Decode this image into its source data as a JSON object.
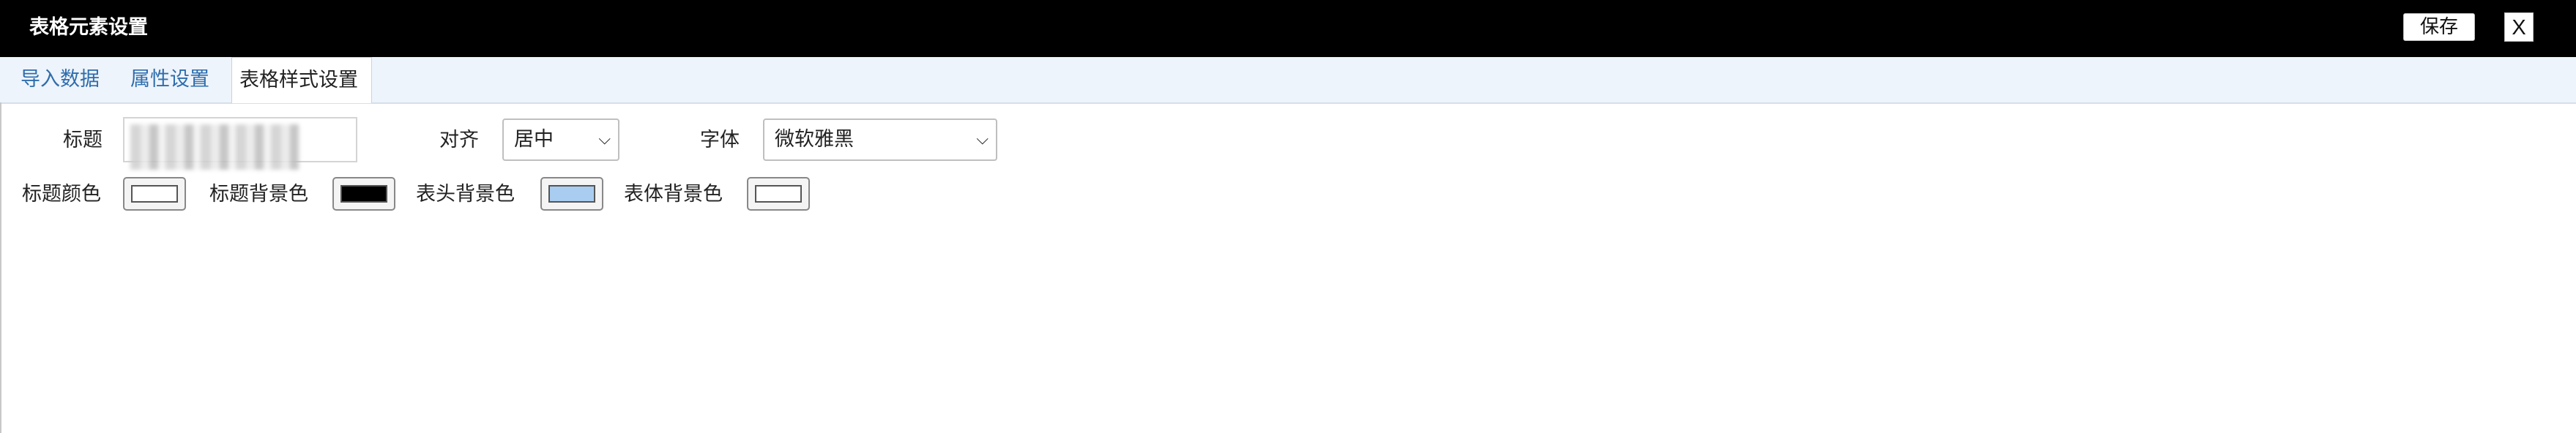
{
  "window": {
    "title": "表格元素设置",
    "save_label": "保存",
    "close_label": "X"
  },
  "tabs": [
    {
      "label": "导入数据",
      "active": false
    },
    {
      "label": "属性设置",
      "active": false
    },
    {
      "label": "表格样式设置",
      "active": true
    }
  ],
  "form": {
    "title_label": "标题",
    "title_value": "",
    "align_label": "对齐",
    "align_value": "居中",
    "font_label": "字体",
    "font_value": "微软雅黑",
    "colors": [
      {
        "label": "标题颜色",
        "color": "#ffffff"
      },
      {
        "label": "标题背景色",
        "color": "#000000"
      },
      {
        "label": "表头背景色",
        "color": "#a8cdf0"
      },
      {
        "label": "表体背景色",
        "color": "#ffffff"
      }
    ]
  }
}
